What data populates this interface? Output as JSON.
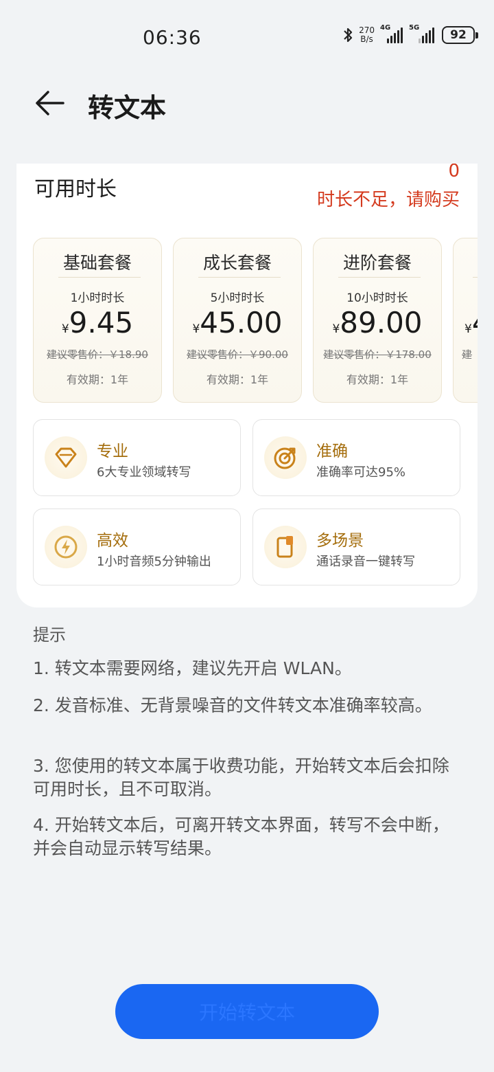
{
  "status_bar": {
    "time": "06:36",
    "net_speed_value": "270",
    "net_speed_unit": "B/s",
    "sig1_label": "4G",
    "sig2_label": "5G",
    "battery": "92"
  },
  "header": {
    "title": "转文本"
  },
  "available": {
    "label": "可用时长",
    "value": "0",
    "tip": "时长不足，请购买"
  },
  "plans": [
    {
      "name": "基础套餐",
      "duration": "1小时时长",
      "currency": "¥",
      "price": "9.45",
      "retail": "建议零售价：￥18.90",
      "validity": "有效期：1年"
    },
    {
      "name": "成长套餐",
      "duration": "5小时时长",
      "currency": "¥",
      "price": "45.00",
      "retail": "建议零售价：￥90.00",
      "validity": "有效期：1年"
    },
    {
      "name": "进阶套餐",
      "duration": "10小时时长",
      "currency": "¥",
      "price": "89.00",
      "retail": "建议零售价：￥178.00",
      "validity": "有效期：1年"
    },
    {
      "name": "",
      "duration": "",
      "currency": "¥",
      "price": "4",
      "retail": "建",
      "validity": ""
    }
  ],
  "features": [
    {
      "title": "专业",
      "desc": "6大专业领域转写",
      "icon": "diamond-icon"
    },
    {
      "title": "准确",
      "desc": "准确率可达95%",
      "icon": "target-icon"
    },
    {
      "title": "高效",
      "desc": "1小时音频5分钟输出",
      "icon": "lightning-icon"
    },
    {
      "title": "多场景",
      "desc": "通话录音一键转写",
      "icon": "phone-recording-icon"
    }
  ],
  "tips": {
    "title": "提示",
    "items": [
      "1. 转文本需要网络，建议先开启 WLAN。",
      "2. 发音标准、无背景噪音的文件转文本准确率较高。",
      "3. 您使用的转文本属于收费功能，开始转文本后会扣除可用时长，且不可取消。",
      "4. 开始转文本后，可离开转文本界面，转写不会中断，并会自动显示转写结果。"
    ]
  },
  "action_button": {
    "label": "开始转文本"
  },
  "colors": {
    "accent_blue": "#1a67f2",
    "warning_red": "#d43a1e",
    "gold": "#a46d0c"
  }
}
